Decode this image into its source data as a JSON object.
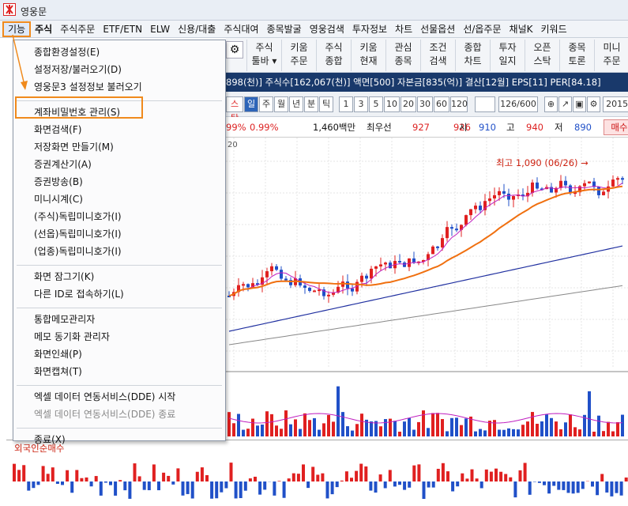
{
  "window": {
    "title": "영웅문"
  },
  "menubar": {
    "items": [
      "기능",
      "주식",
      "주식주문",
      "ETF/ETN",
      "ELW",
      "신용/대출",
      "주식대여",
      "종목발굴",
      "영웅검색",
      "투자정보",
      "차트",
      "선물옵션",
      "선/옵주문",
      "채널K",
      "키워드"
    ]
  },
  "toolbar": {
    "buttons": [
      {
        "l1": "주식",
        "l2": "툴바 ▾"
      },
      {
        "l1": "키움",
        "l2": "주문"
      },
      {
        "l1": "주식",
        "l2": "종합"
      },
      {
        "l1": "키움",
        "l2": "현재"
      },
      {
        "l1": "관심",
        "l2": "종목"
      },
      {
        "l1": "조건",
        "l2": "검색"
      },
      {
        "l1": "종합",
        "l2": "차트"
      },
      {
        "l1": "투자",
        "l2": "일지"
      },
      {
        "l1": "오픈",
        "l2": "스탁"
      },
      {
        "l1": "종목",
        "l2": "토론"
      },
      {
        "l1": "미니",
        "l2": "주문"
      }
    ]
  },
  "infobar": {
    "text": "898(천)] 주식수[162,067(천)] 액면[500] 자본금[835(억)] 결산[12월] EPS[11] PER[84.18]"
  },
  "ctrlbar": {
    "tag": "스탁",
    "periods": [
      "일",
      "주",
      "월",
      "년",
      "분",
      "틱"
    ],
    "numbers": [
      "1",
      "3",
      "5",
      "10",
      "20",
      "30",
      "60",
      "120"
    ],
    "counter": "126/600",
    "date": "2015/"
  },
  "quote": {
    "pct1": "99%",
    "pct2": "0.99%",
    "volume": "1,460백만",
    "seller": "최우선",
    "p1": "927",
    "p2": "926",
    "l_open": "시",
    "v_open": "910",
    "l_high": "고",
    "v_high": "940",
    "l_low": "저",
    "v_low": "890",
    "action": "매수"
  },
  "chart_data": {
    "type": "candlestick",
    "annotation": "최고 1,090 (06/26) →",
    "top_tick": "20",
    "lower_panel_title": "외국인순매수"
  },
  "dropdown": {
    "items": [
      {
        "label": "종합환경설정(E)",
        "group": 0
      },
      {
        "label": "설정저장/불러오기(D)",
        "group": 0
      },
      {
        "label": "영웅문3 설정정보 불러오기",
        "group": 0
      },
      {
        "label": "계좌비밀번호 관리(S)",
        "group": 1
      },
      {
        "label": "화면검색(F)",
        "group": 1
      },
      {
        "label": "저장화면 만들기(M)",
        "group": 1
      },
      {
        "label": "증권계산기(A)",
        "group": 1
      },
      {
        "label": "증권방송(B)",
        "group": 1
      },
      {
        "label": "미니시계(C)",
        "group": 1
      },
      {
        "label": "(주식)독립미니호가(I)",
        "group": 1
      },
      {
        "label": "(선옵)독립미니호가(I)",
        "group": 1
      },
      {
        "label": "(업종)독립미니호가(I)",
        "group": 1
      },
      {
        "label": "화면 잠그기(K)",
        "group": 2
      },
      {
        "label": "다른 ID로 접속하기(L)",
        "group": 2
      },
      {
        "label": "통합메모관리자",
        "group": 3
      },
      {
        "label": "메모 동기화 관리자",
        "group": 3
      },
      {
        "label": "화면인쇄(P)",
        "group": 3
      },
      {
        "label": "화면캡쳐(T)",
        "group": 3
      },
      {
        "label": "엑셀 데이터 연동서비스(DDE) 시작",
        "group": 4
      },
      {
        "label": "엑셀 데이터 연동서비스(DDE) 종료",
        "group": 4,
        "disabled": true
      },
      {
        "label": "종료(X)",
        "group": 5
      }
    ],
    "highlighted": "계좌비밀번호 관리(S)"
  },
  "colors": {
    "accent": "#f08a1c",
    "up": "#e02020",
    "down": "#2050c8",
    "infobar": "#19396b"
  }
}
